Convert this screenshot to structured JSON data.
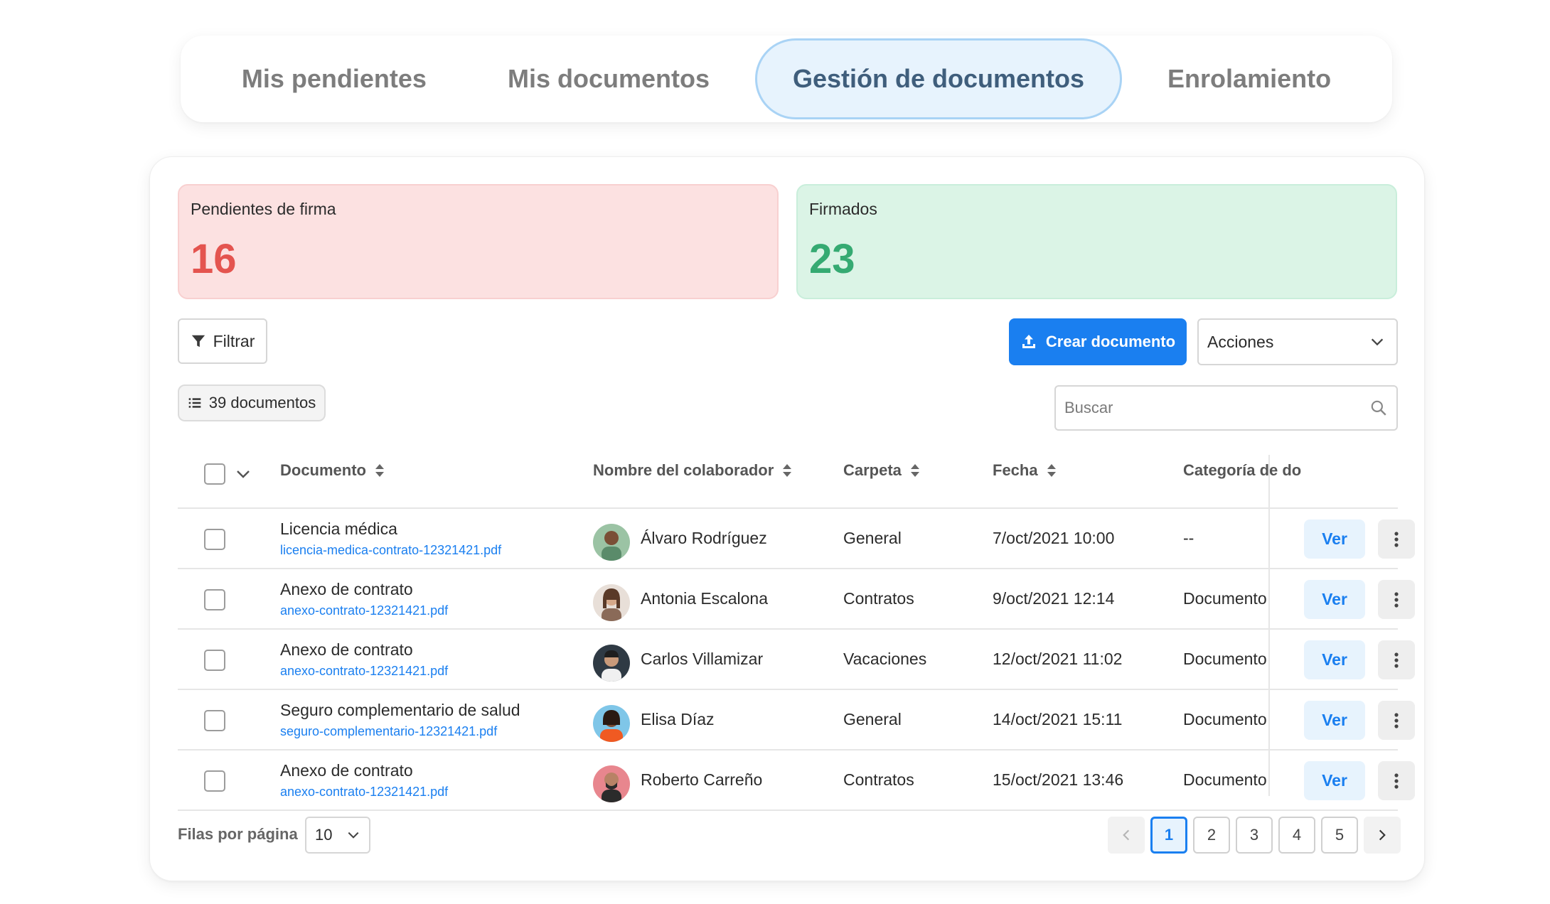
{
  "tabs": [
    {
      "label": "Mis pendientes",
      "active": false
    },
    {
      "label": "Mis documentos",
      "active": false
    },
    {
      "label": "Gestión de documentos",
      "active": true
    },
    {
      "label": "Enrolamiento",
      "active": false
    }
  ],
  "stats": {
    "pending": {
      "label": "Pendientes de firma",
      "value": "16",
      "color": "#e4544f"
    },
    "signed": {
      "label": "Firmados",
      "value": "23",
      "color": "#35aa72"
    }
  },
  "toolbar": {
    "filter_label": "Filtrar",
    "create_label": "Crear documento",
    "actions_label": "Acciones",
    "count_label": "39 documentos",
    "search_placeholder": "Buscar",
    "accent_color": "#1a7ff0"
  },
  "table": {
    "headers": {
      "document": "Documento",
      "employee": "Nombre del colaborador",
      "folder": "Carpeta",
      "date": "Fecha",
      "category": "Categoría de do"
    },
    "view_label": "Ver",
    "rows": [
      {
        "title": "Licencia médica",
        "file": "licencia-medica-contrato-12321421.pdf",
        "employee": "Álvaro Rodríguez",
        "folder": "General",
        "date": "7/oct/2021 10:00",
        "category": "--"
      },
      {
        "title": "Anexo de contrato",
        "file": "anexo-contrato-12321421.pdf",
        "employee": "Antonia Escalona",
        "folder": "Contratos",
        "date": "9/oct/2021 12:14",
        "category": "Documento"
      },
      {
        "title": "Anexo de contrato",
        "file": "anexo-contrato-12321421.pdf",
        "employee": "Carlos Villamizar",
        "folder": "Vacaciones",
        "date": "12/oct/2021 11:02",
        "category": "Documento"
      },
      {
        "title": "Seguro complementario de salud",
        "file": "seguro-complementario-12321421.pdf",
        "employee": "Elisa Díaz",
        "folder": "General",
        "date": "14/oct/2021 15:11",
        "category": "Documento"
      },
      {
        "title": "Anexo de contrato",
        "file": "anexo-contrato-12321421.pdf",
        "employee": "Roberto Carreño",
        "folder": "Contratos",
        "date": "15/oct/2021 13:46",
        "category": "Documento"
      }
    ]
  },
  "footer": {
    "rows_per_page_label": "Filas por página",
    "rows_per_page_value": "10",
    "pages": [
      "1",
      "2",
      "3",
      "4",
      "5"
    ],
    "current_page": "1"
  },
  "icons": [
    "filter-icon",
    "upload-icon",
    "chevron-down-icon",
    "list-icon",
    "search-icon",
    "sort-icon",
    "more-vertical-icon",
    "chevron-left-icon",
    "chevron-right-icon"
  ]
}
